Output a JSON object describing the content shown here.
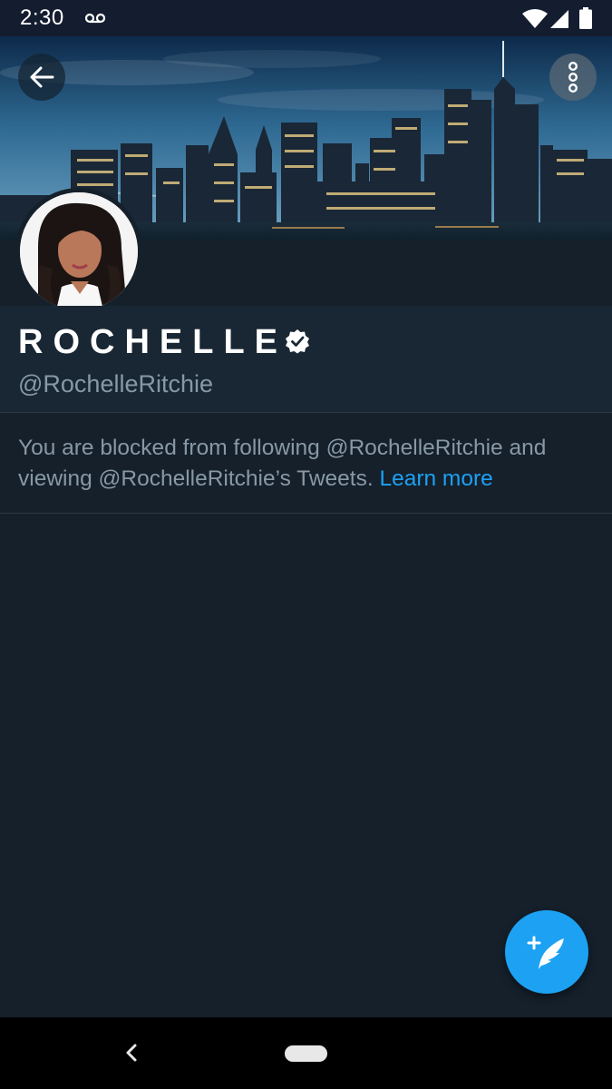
{
  "status_bar": {
    "time": "2:30",
    "icons": [
      "voicemail-icon",
      "wifi-icon",
      "cellular-signal-icon",
      "battery-icon"
    ]
  },
  "header": {
    "banner": "city-skyline-night-photo",
    "back_icon": "arrow-left-icon",
    "more_icon": "more-vertical-icon"
  },
  "profile": {
    "display_name": "ROCHELLE",
    "verified": true,
    "handle": "@RochelleRitchie",
    "avatar": "profile-photo"
  },
  "blocked_notice": {
    "text": "You are blocked from following @RochelleRitchie and viewing @RochelleRitchie’s Tweets.",
    "link_label": "Learn more"
  },
  "fab": {
    "icon": "compose-tweet-icon"
  },
  "nav_bar": {
    "back_icon": "chevron-left-icon",
    "home_icon": "home-pill-icon"
  },
  "colors": {
    "background": "#15202b",
    "surface": "#192734",
    "accent": "#1da1f2",
    "secondary_text": "#8899a6"
  }
}
